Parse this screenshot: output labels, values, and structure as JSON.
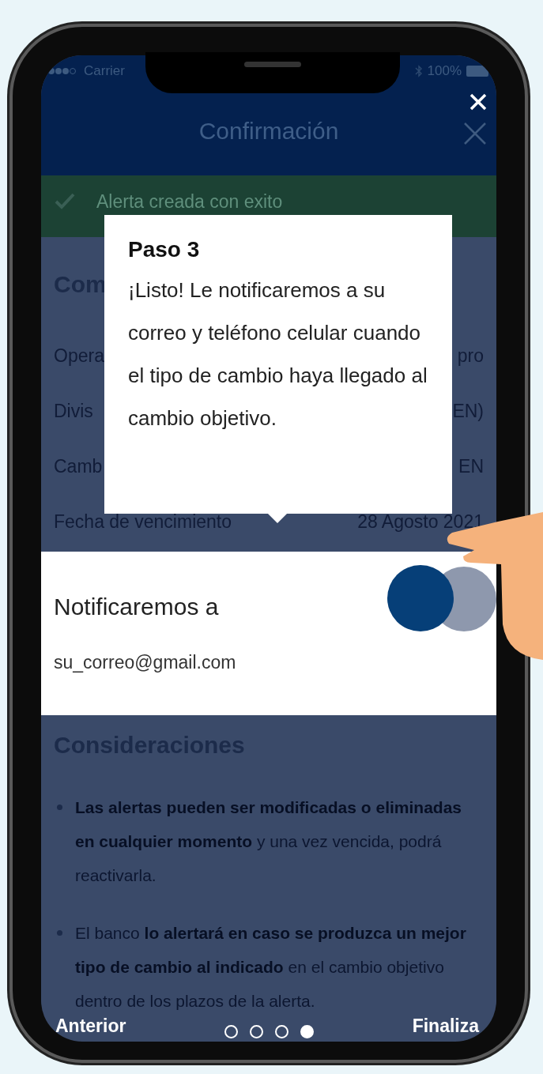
{
  "status_bar": {
    "carrier": "Carrier",
    "battery": "100%"
  },
  "header": {
    "title": "Confirmación"
  },
  "banner": {
    "text": "Alerta creada con exito"
  },
  "summary": {
    "heading": "Com",
    "rows": [
      {
        "label": "Opera",
        "value": "pro"
      },
      {
        "label": "Divis",
        "value": "EN)"
      },
      {
        "label": "Camb",
        "value": "EN"
      },
      {
        "label": "Fecha de vencimiento",
        "value": "28 Agosto 2021"
      }
    ]
  },
  "tooltip": {
    "title": "Paso 3",
    "text": "¡Listo! Le notificaremos a su correo y teléfono celular cuando el tipo de cambio haya llegado al cambio objetivo."
  },
  "notify": {
    "label": "Notificaremos a",
    "email": "su_correo@gmail.com",
    "toggle": {
      "on": true
    }
  },
  "considerations": {
    "heading": "Consideraciones",
    "items": [
      "**Las alertas pueden ser modificadas o eliminadas en cualquier momento** y una vez vencida, podrá reactivarla.",
      "El banco **lo alertará en caso se produzca un mejor tipo de cambio al indicado** en el cambio objetivo dentro de los plazos de la alerta."
    ]
  },
  "nav": {
    "previous": "Anterior",
    "next": "Finaliza",
    "pages": [
      {
        "selected": false
      },
      {
        "selected": false
      },
      {
        "selected": false
      },
      {
        "selected": true
      }
    ]
  }
}
